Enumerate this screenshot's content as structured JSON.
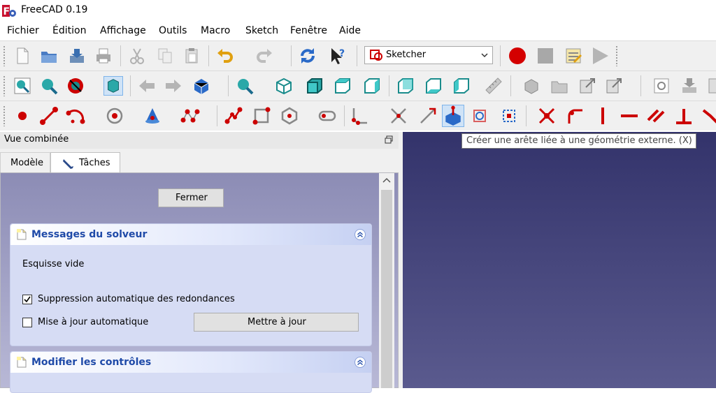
{
  "window": {
    "title": "FreeCAD 0.19"
  },
  "menu": [
    "Fichier",
    "Édition",
    "Affichage",
    "Outils",
    "Macro",
    "Sketch",
    "Fenêtre",
    "Aide"
  ],
  "workbench": {
    "selected": "Sketcher"
  },
  "combo_view": {
    "title": "Vue combinée",
    "tabs": [
      {
        "label": "Modèle"
      },
      {
        "label": "Tâches"
      }
    ]
  },
  "tasks": {
    "close_label": "Fermer",
    "solver": {
      "title": "Messages du solveur",
      "status": "Esquisse vide",
      "auto_remove_redundants": {
        "label": "Suppression automatique des redondances",
        "checked": true
      },
      "auto_update": {
        "label": "Mise à jour automatique",
        "checked": false
      },
      "update_label": "Mettre à jour"
    },
    "edit_controls": {
      "title": "Modifier les contrôles"
    }
  },
  "tooltip": {
    "text": "Créer une arête liée à une géométrie externe. (X)"
  },
  "colors": {
    "sketch_red": "#cc0000",
    "accent_blue": "#1f4aa8",
    "teal": "#1a8c8c",
    "viewport_top": "#33336b",
    "viewport_bottom": "#5a5a8e"
  },
  "icons": {
    "toolbar1": [
      "new-file-icon",
      "open-folder-icon",
      "save-icon",
      "print-icon",
      "cut-icon",
      "copy-icon",
      "paste-icon",
      "undo-icon",
      "redo-icon",
      "refresh-icon",
      "whats-this-icon",
      "workbench-sketcher-icon",
      "macro-record-icon",
      "macro-stop-icon",
      "macro-edit-icon",
      "macro-play-icon"
    ],
    "toolbar2": [
      "fit-all-icon",
      "fit-selection-icon",
      "draw-style-icon",
      "bounding-box-icon",
      "back-icon",
      "forward-icon",
      "std-views-icon",
      "zoom-icon",
      "isometric-icon",
      "front-view-icon",
      "top-view-icon",
      "right-view-icon",
      "rear-view-icon",
      "bottom-view-icon",
      "left-view-icon",
      "measure-icon",
      "part-icon",
      "group-icon",
      "link-icon",
      "link-actions-icon",
      "sketch-view-icon",
      "sketch-import-icon",
      "sketch-leave-icon"
    ],
    "toolbar3": [
      "create-point-icon",
      "create-line-icon",
      "create-arc-icon",
      "create-circle-icon",
      "create-conic-icon",
      "create-bspline-icon",
      "create-polyline-icon",
      "create-rectangle-icon",
      "create-polygon-icon",
      "create-slot-icon",
      "create-fillet-icon",
      "trim-edge-icon",
      "extend-edge-icon",
      "external-geometry-icon",
      "carbon-copy-icon",
      "construction-mode-icon",
      "constrain-coincident-icon",
      "constrain-point-on-object-icon",
      "constrain-vertical-icon",
      "constrain-horizontal-icon",
      "constrain-parallel-icon",
      "constrain-perpendicular-icon",
      "constrain-tangent-icon"
    ]
  }
}
